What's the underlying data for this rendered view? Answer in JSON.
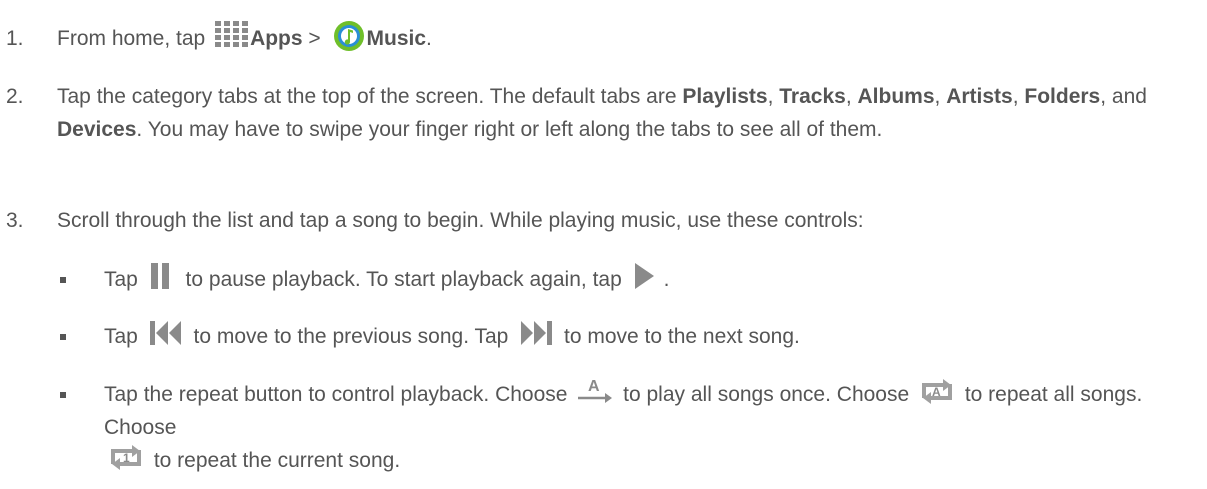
{
  "steps": [
    {
      "number": "1.",
      "text_before": "From home, tap ",
      "apps_label": "Apps",
      "sep": " > ",
      "music_label": "Music",
      "end": "."
    },
    {
      "number": "2.",
      "intro": "Tap the category tabs at the top of the screen. The default tabs are ",
      "tabs": [
        "Playlists",
        "Tracks",
        "Albums",
        "Artists",
        "Folders",
        "Devices"
      ],
      "sep_comma": ", ",
      "and": ", and ",
      "outro": ". You may have to swipe your finger right or left along the tabs to see all of them."
    },
    {
      "number": "3.",
      "text": "Scroll through the list and tap a song to begin. While playing music, use these controls:"
    }
  ],
  "bullets": [
    {
      "tap": "Tap ",
      "mid": " to pause playback. To start playback again, tap ",
      "end": "."
    },
    {
      "tap": "Tap ",
      "mid": " to move to the previous song. Tap ",
      "end": " to move to the next song."
    },
    {
      "intro": "Tap the repeat button to control playback. Choose ",
      "opt1": " to play all songs once. Choose ",
      "opt2": " to repeat all songs. Choose ",
      "opt3": " to repeat the current song."
    }
  ],
  "icons": {
    "apps": "apps-grid-icon",
    "music": "music-app-icon",
    "pause": "pause-icon",
    "play": "play-icon",
    "previous": "previous-track-icon",
    "next": "next-track-icon",
    "repeat_off": "repeat-off-icon",
    "repeat_all": "repeat-all-icon",
    "repeat_one": "repeat-one-icon"
  },
  "colors": {
    "text": "#555555",
    "icon_gray": "#8a8a8a",
    "music_green": "#6fbf2a",
    "music_blue": "#2a8fd6"
  }
}
